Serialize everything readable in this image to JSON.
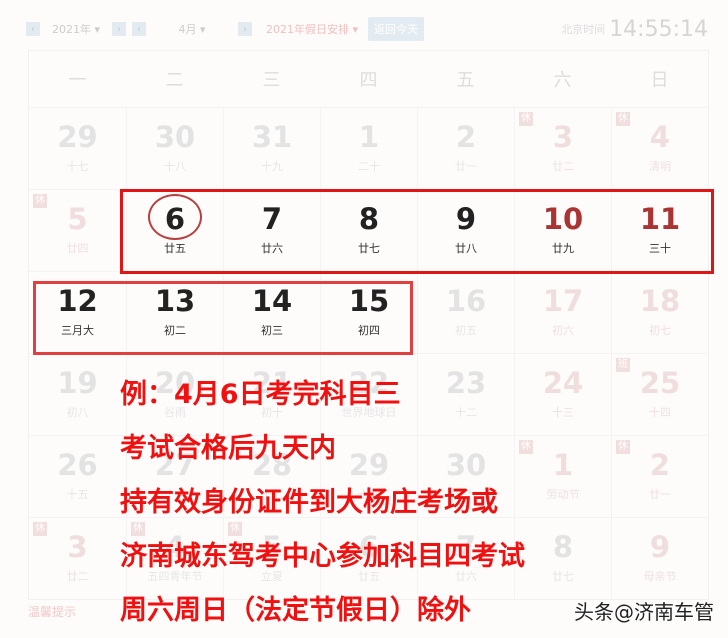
{
  "toolbar": {
    "year": "2021年",
    "month": "4月",
    "holiday_select": "2021年假日安排",
    "today_button": "返回今天",
    "beijing_label": "北京时间",
    "clock": "14:55:14"
  },
  "weekdays": [
    "一",
    "二",
    "三",
    "四",
    "五",
    "六",
    "日"
  ],
  "weeks": [
    [
      {
        "d": "29",
        "l": "十七"
      },
      {
        "d": "30",
        "l": "十八"
      },
      {
        "d": "31",
        "l": "十九"
      },
      {
        "d": "1",
        "l": "二十"
      },
      {
        "d": "2",
        "l": "廿一"
      },
      {
        "d": "3",
        "l": "廿二",
        "b": "休",
        "r": 1
      },
      {
        "d": "4",
        "l": "清明",
        "b": "休",
        "r": 1
      }
    ],
    [
      {
        "d": "5",
        "l": "廿四",
        "b": "休",
        "r": 1
      },
      {
        "d": "6",
        "l": "廿五",
        "on": 1
      },
      {
        "d": "7",
        "l": "廿六",
        "on": 1
      },
      {
        "d": "8",
        "l": "廿七",
        "on": 1
      },
      {
        "d": "9",
        "l": "廿八",
        "on": 1
      },
      {
        "d": "10",
        "l": "廿九",
        "on": 1,
        "r": 1
      },
      {
        "d": "11",
        "l": "三十",
        "on": 1,
        "r": 1
      }
    ],
    [
      {
        "d": "12",
        "l": "三月大",
        "on": 1
      },
      {
        "d": "13",
        "l": "初二",
        "on": 1
      },
      {
        "d": "14",
        "l": "初三",
        "on": 1
      },
      {
        "d": "15",
        "l": "初四",
        "on": 1
      },
      {
        "d": "16",
        "l": "初五"
      },
      {
        "d": "17",
        "l": "初六",
        "r": 1
      },
      {
        "d": "18",
        "l": "初七",
        "r": 1
      }
    ],
    [
      {
        "d": "19",
        "l": "初八"
      },
      {
        "d": "20",
        "l": "谷雨"
      },
      {
        "d": "21",
        "l": "初十"
      },
      {
        "d": "22",
        "l": "世界地球日"
      },
      {
        "d": "23",
        "l": "十二"
      },
      {
        "d": "24",
        "l": "十三",
        "r": 1
      },
      {
        "d": "25",
        "l": "十四",
        "b": "班",
        "r": 1
      }
    ],
    [
      {
        "d": "26",
        "l": "十五"
      },
      {
        "d": "27",
        "l": "十六"
      },
      {
        "d": "28",
        "l": "十七"
      },
      {
        "d": "29",
        "l": "十八"
      },
      {
        "d": "30",
        "l": "十九"
      },
      {
        "d": "1",
        "l": "劳动节",
        "b": "休",
        "r": 1
      },
      {
        "d": "2",
        "l": "廿一",
        "b": "休",
        "r": 1
      }
    ],
    [
      {
        "d": "3",
        "l": "廿二",
        "b": "休",
        "r": 1
      },
      {
        "d": "4",
        "l": "五四青年节",
        "b": "休"
      },
      {
        "d": "5",
        "l": "立夏",
        "b": "休"
      },
      {
        "d": "6",
        "l": "廿五"
      },
      {
        "d": "7",
        "l": "廿六"
      },
      {
        "d": "8",
        "l": "廿七"
      },
      {
        "d": "9",
        "l": "母亲节",
        "r": 1
      }
    ]
  ],
  "note": [
    "例：4月6日考完科目三",
    "考试合格后九天内",
    "持有效身份证件到大杨庄考场或",
    "济南城东驾考中心参加科目四考试",
    "周六周日（法定节假日）除外"
  ],
  "footer": "温馨提示",
  "watermark": "头条@济南车管"
}
